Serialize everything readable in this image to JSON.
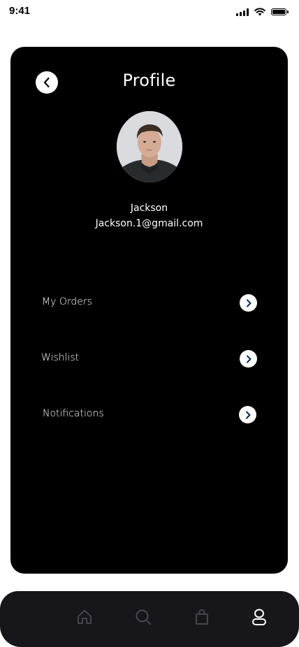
{
  "status_bar": {
    "time": "9:41"
  },
  "header": {
    "title": "Profile"
  },
  "user": {
    "name": "Jackson",
    "email": "Jackson.1@gmail.com"
  },
  "menu": {
    "items": [
      {
        "label": "My Orders"
      },
      {
        "label": "Wishlist"
      },
      {
        "label": "Notifications"
      }
    ]
  },
  "bottom_nav": {
    "tabs": [
      {
        "icon": "home-icon",
        "active": false
      },
      {
        "icon": "search-icon",
        "active": false
      },
      {
        "icon": "shopping-bag-icon",
        "active": false
      },
      {
        "icon": "user-icon",
        "active": true
      }
    ]
  },
  "colors": {
    "card_background": "#000000",
    "nav_background": "#16161b",
    "inactive_icon": "#45454d",
    "active_icon": "#ffffff",
    "arrow_icon": "#0e2a52"
  }
}
